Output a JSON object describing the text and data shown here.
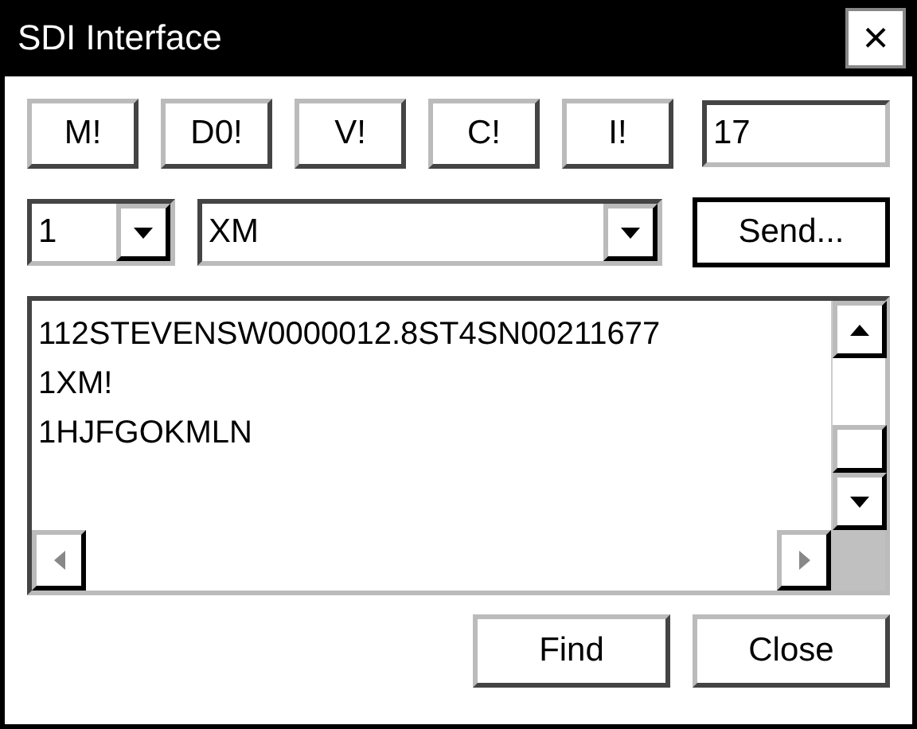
{
  "window": {
    "title": "SDI Interface",
    "close": "×"
  },
  "command_buttons": [
    "M!",
    "D0!",
    "V!",
    "C!",
    "I!"
  ],
  "address_field": {
    "value": "17"
  },
  "sensor_select": {
    "value": "1"
  },
  "command_select": {
    "value": "XM"
  },
  "send_button": "Send...",
  "log_lines": [
    "112STEVENSW0000012.8ST4SN00211677",
    "1XM!",
    "1HJFGOKMLN"
  ],
  "buttons": [
    "Find",
    "Close"
  ]
}
